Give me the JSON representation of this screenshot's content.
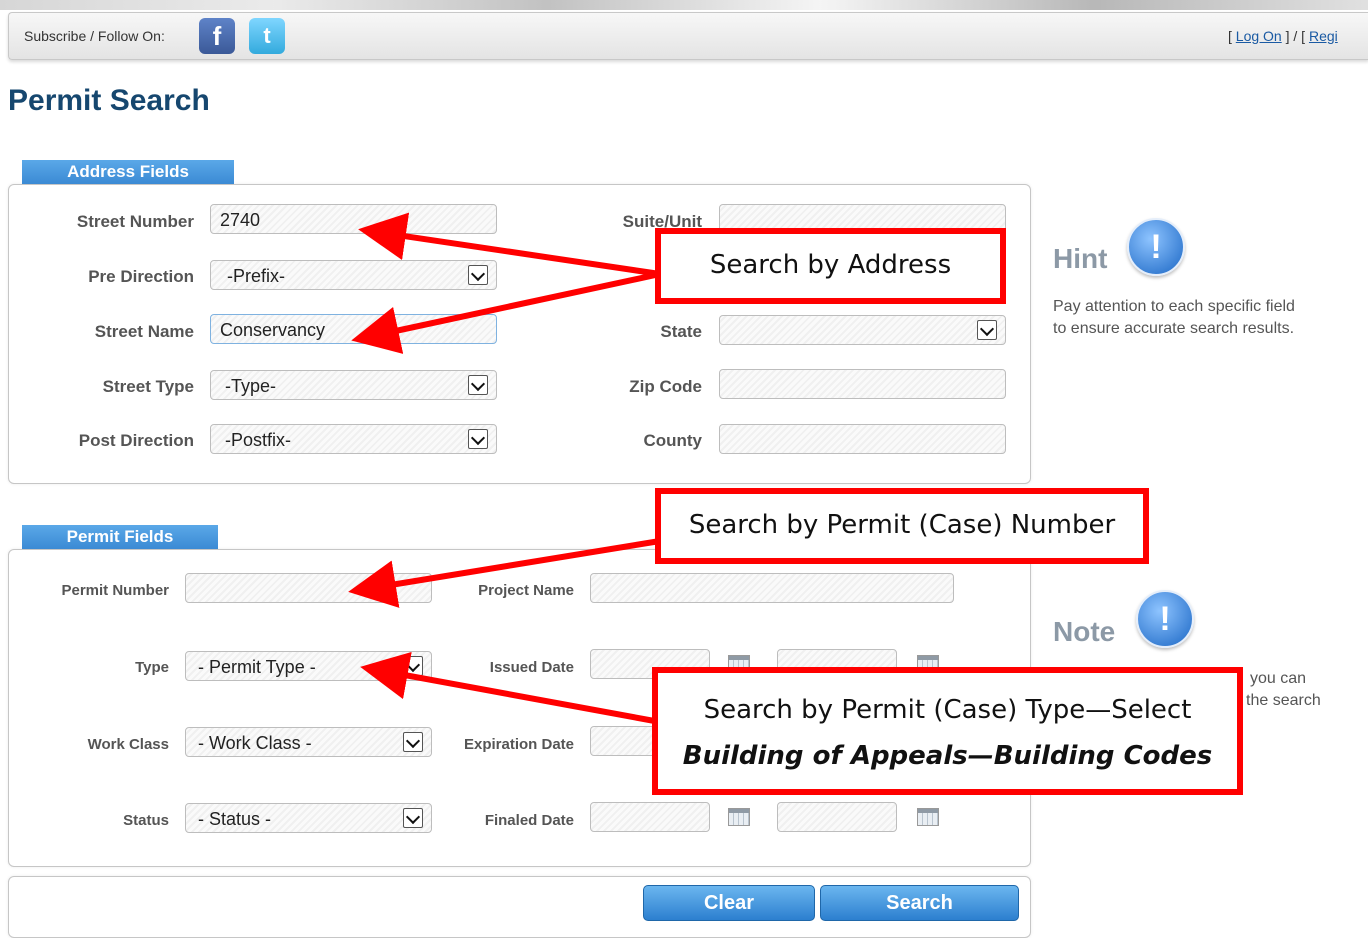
{
  "header": {
    "subscribe_label": "Subscribe / Follow On:",
    "facebook_icon": "f",
    "twitter_icon": "t",
    "login_open": "[ ",
    "login_link": "Log On",
    "login_sep": " ] / [ ",
    "register_link": "Regi"
  },
  "page_title": "Permit Search",
  "address": {
    "tab_label": "Address Fields",
    "street_number": {
      "label": "Street Number",
      "value": "2740"
    },
    "pre_direction": {
      "label": "Pre Direction",
      "value": "-Prefix-"
    },
    "street_name": {
      "label": "Street Name",
      "value": "Conservancy"
    },
    "street_type": {
      "label": "Street Type",
      "value": "-Type-"
    },
    "post_direction": {
      "label": "Post Direction",
      "value": "-Postfix-"
    },
    "suite_unit": {
      "label": "Suite/Unit",
      "value": ""
    },
    "state": {
      "label": "State",
      "value": ""
    },
    "zip_code": {
      "label": "Zip Code",
      "value": ""
    },
    "county": {
      "label": "County",
      "value": ""
    }
  },
  "permit": {
    "tab_label": "Permit Fields",
    "permit_number": {
      "label": "Permit Number",
      "value": ""
    },
    "type": {
      "label": "Type",
      "value": "- Permit Type -"
    },
    "work_class": {
      "label": "Work Class",
      "value": "- Work Class -"
    },
    "status": {
      "label": "Status",
      "value": "- Status -"
    },
    "project_name": {
      "label": "Project Name",
      "value": ""
    },
    "issued_date": {
      "label": "Issued Date"
    },
    "expiration_date": {
      "label": "Expiration Date"
    },
    "finaled_date": {
      "label": "Finaled Date"
    }
  },
  "buttons": {
    "clear": "Clear",
    "search": "Search"
  },
  "hint": {
    "title": "Hint",
    "icon": "!",
    "line1": "Pay attention to each specific field",
    "line2": "to ensure accurate search results."
  },
  "note": {
    "title": "Note",
    "icon": "!",
    "line1_partial": "you can",
    "line2_partial": "the search"
  },
  "callouts": {
    "address": "Search by Address",
    "permit_number": "Search by Permit (Case) Number",
    "permit_type_line1": "Search by Permit (Case) Type—Select",
    "permit_type_line2": "Building of Appeals—Building Codes"
  },
  "colors": {
    "callout_border": "#ff0000",
    "button_blue": "#2c7fcf",
    "title_blue": "#16476f",
    "tab_blue": "#3b8ad4"
  }
}
